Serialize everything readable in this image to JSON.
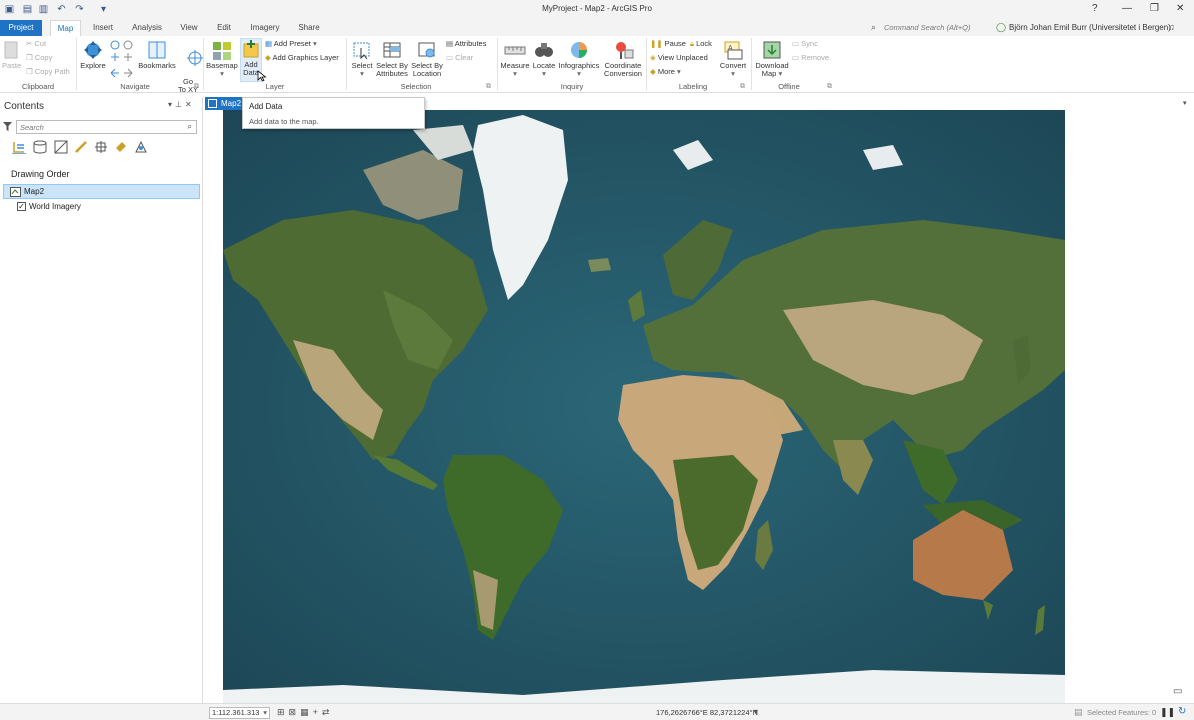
{
  "window": {
    "title": "MyProject - Map2 - ArcGIS Pro",
    "help": "?",
    "minimize": "—",
    "restore": "❐",
    "close": "✕"
  },
  "tabs": [
    {
      "label": "Project"
    },
    {
      "label": "Map"
    },
    {
      "label": "Insert"
    },
    {
      "label": "Analysis"
    },
    {
      "label": "View"
    },
    {
      "label": "Edit"
    },
    {
      "label": "Imagery"
    },
    {
      "label": "Share"
    }
  ],
  "command_search": {
    "placeholder": "Command Search (Alt+Q)"
  },
  "user": {
    "name": "Björn Johan Emil Burr (Universitetet i Bergen)"
  },
  "ribbon": {
    "clipboard": {
      "paste": "Paste",
      "cut": "Cut",
      "copy": "Copy",
      "copy_path": "Copy Path",
      "label": "Clipboard"
    },
    "navigate": {
      "explore": "Explore",
      "bookmarks": "Bookmarks",
      "go_to_xy": "Go\nTo XY",
      "label": "Navigate"
    },
    "layer": {
      "basemap": "Basemap",
      "add_data_1": "Add",
      "add_data_2": "Data",
      "add_preset": "Add Preset",
      "add_graphics_layer": "Add Graphics Layer",
      "label": "Layer"
    },
    "selection": {
      "select": "Select",
      "select_by_attributes_1": "Select By",
      "select_by_attributes_2": "Attributes",
      "select_by_location_1": "Select By",
      "select_by_location_2": "Location",
      "attributes": "Attributes",
      "clear": "Clear",
      "label": "Selection"
    },
    "inquiry": {
      "measure": "Measure",
      "locate": "Locate",
      "infographics": "Infographics",
      "coordinate_conversion_1": "Coordinate",
      "coordinate_conversion_2": "Conversion",
      "label": "Inquiry"
    },
    "labeling": {
      "pause": "Pause",
      "lock": "Lock",
      "view_unplaced": "View Unplaced",
      "more": "More",
      "convert": "Convert",
      "label": "Labeling"
    },
    "offline": {
      "download_map_1": "Download",
      "download_map_2": "Map",
      "sync": "Sync",
      "remove": "Remove",
      "label": "Offline"
    }
  },
  "contents": {
    "title": "Contents",
    "search_placeholder": "Search",
    "drawing_order": "Drawing Order",
    "map_name": "Map2",
    "layers": [
      {
        "name": "World Imagery",
        "checked": true
      }
    ]
  },
  "map_tab": {
    "label": "Map2"
  },
  "tooltip": {
    "title": "Add Data",
    "description": "Add data to the map."
  },
  "status": {
    "scale": "1:112.361.313",
    "coordinates": "176,2626766°E 82,3721224°N",
    "selected_features": "Selected Features: 0"
  },
  "colors": {
    "accent": "#1f73c4",
    "ocean": "#23505f",
    "land": "#4d6b32",
    "desert": "#c8a77a",
    "ice": "#eef2f3"
  }
}
